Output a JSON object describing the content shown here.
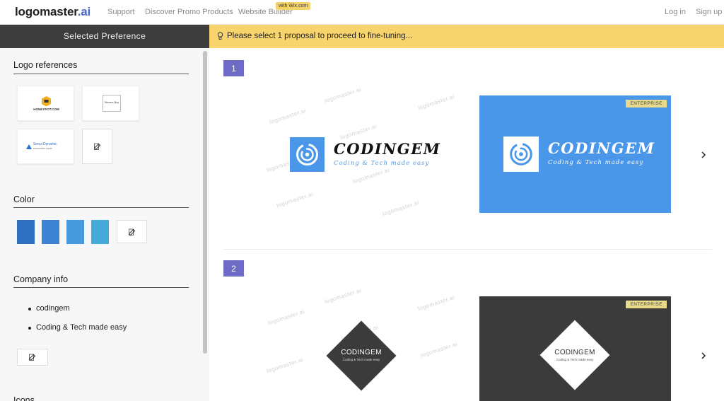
{
  "nav": {
    "brand_main": "logomaster",
    "brand_suffix": ".ai",
    "links": [
      "Support",
      "Discover Promo Products",
      "Website Builder"
    ],
    "builder_badge": "with Wix.com",
    "login": "Log in",
    "signup": "Sign up"
  },
  "sidebar": {
    "header": "Selected Preference",
    "logo_references_title": "Logo references",
    "references": [
      {
        "name": "HONEYPOT.COM"
      },
      {
        "name": "Marina Bay"
      },
      {
        "name": "Seoul Dynamic",
        "sub": "automotive repair"
      }
    ],
    "color_title": "Color",
    "swatches": [
      "#2e6fc0",
      "#3c84d2",
      "#4599dc",
      "#46a9db"
    ],
    "company_info_title": "Company info",
    "company_info": [
      "codingem",
      "Coding & Tech made easy"
    ],
    "icons_title": "Icons"
  },
  "banner": {
    "text": "Please select 1 proposal to proceed to fine-tuning..."
  },
  "proposals": [
    {
      "number": "1",
      "brand": "CODINGEM",
      "tagline": "Coding & Tech made easy",
      "badge": "ENTERPRISE",
      "preview_bg": "#4a97ea"
    },
    {
      "number": "2",
      "brand": "CODINGEM",
      "tagline": "Coding & Tech made easy",
      "badge": "ENTERPRISE",
      "preview_bg": "#3b3b3b"
    }
  ],
  "watermark": "logomaster.ai",
  "colors": {
    "accent": "#f8d46c",
    "badge": "#6d6bc5",
    "brand_blue": "#4a68c9"
  }
}
